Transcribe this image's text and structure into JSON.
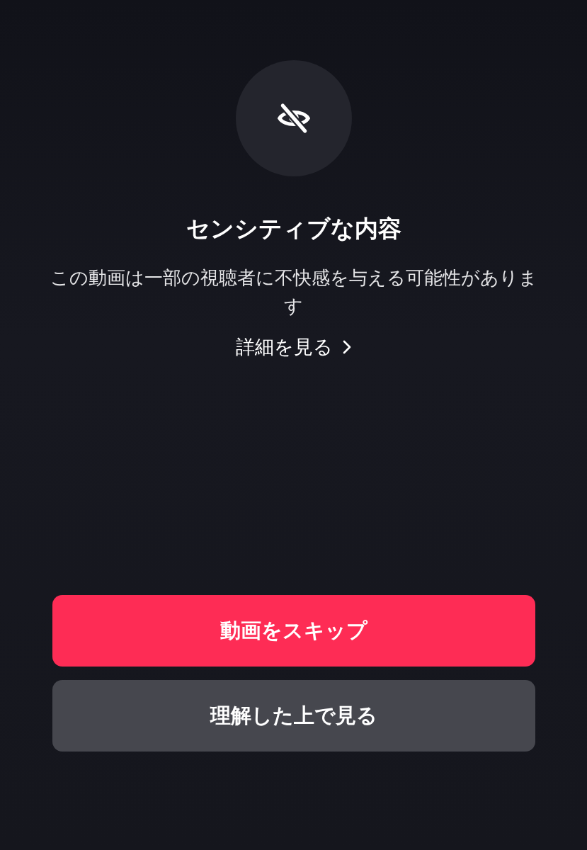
{
  "title": "センシティブな内容",
  "message": "この動画は一部の視聴者に不快感を与える可能性があります",
  "details_link": {
    "label": "詳細を見る"
  },
  "buttons": [
    {
      "label": "動画をスキップ",
      "kind": "primary"
    },
    {
      "label": "理解した上で見る",
      "kind": "secondary"
    }
  ]
}
